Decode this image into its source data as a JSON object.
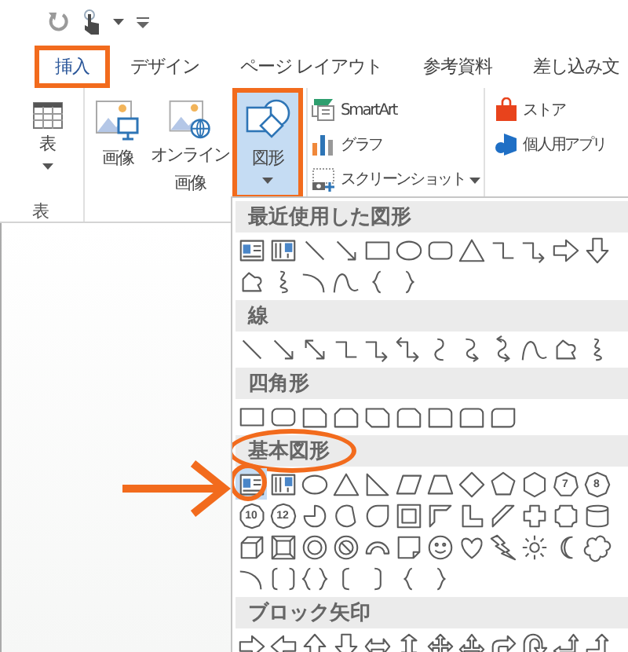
{
  "tabs": [
    {
      "label": "挿入",
      "selected": true,
      "outlined": true
    },
    {
      "label": "デザイン",
      "selected": false,
      "outlined": false
    },
    {
      "label": "ページ レイアウト",
      "selected": false,
      "outlined": false
    },
    {
      "label": "参考資料",
      "selected": false,
      "outlined": false
    },
    {
      "label": "差し込み文",
      "selected": false,
      "outlined": false
    }
  ],
  "ribbon": {
    "groups": [
      {
        "kind": "large",
        "label": "表",
        "items": [
          {
            "kind": "table",
            "label": "表",
            "dropdown": true,
            "pressed": false,
            "outlined": false
          }
        ]
      },
      {
        "kind": "large",
        "items": [
          {
            "kind": "picture",
            "label": "画像",
            "dropdown": false,
            "pressed": false,
            "outlined": false
          },
          {
            "kind": "online-picture",
            "lines": [
              "オンライン",
              "画像"
            ],
            "dropdown": false,
            "pressed": false,
            "outlined": false
          },
          {
            "kind": "shapes",
            "label": "図形",
            "dropdown": true,
            "pressed": true,
            "outlined": true
          }
        ]
      },
      {
        "kind": "small",
        "items": [
          {
            "kind": "smartart",
            "label": "SmartArt",
            "dropdown": false
          },
          {
            "kind": "chart",
            "label": "グラフ",
            "dropdown": false
          },
          {
            "kind": "screenshot",
            "label": "スクリーンショット",
            "dropdown": true
          }
        ]
      },
      {
        "kind": "small",
        "items": [
          {
            "kind": "store",
            "label": "ストア",
            "dropdown": false
          },
          {
            "kind": "apps",
            "label": "個人用アプリ",
            "dropdown": false
          }
        ]
      }
    ]
  },
  "shape_gallery": {
    "sections": [
      {
        "title": "最近使用した図形",
        "circled": false,
        "items": [
          {
            "kind": "text-box",
            "selected": false,
            "circled": false
          },
          {
            "kind": "vertical-text-box",
            "selected": false,
            "circled": false
          },
          {
            "kind": "line",
            "selected": false,
            "circled": false
          },
          {
            "kind": "arrow",
            "selected": false,
            "circled": false
          },
          {
            "kind": "rectangle",
            "selected": false,
            "circled": false
          },
          {
            "kind": "oval",
            "selected": false,
            "circled": false
          },
          {
            "kind": "rounded-rectangle",
            "selected": false,
            "circled": false
          },
          {
            "kind": "triangle",
            "selected": false,
            "circled": false
          },
          {
            "kind": "elbow-connector",
            "selected": false,
            "circled": false
          },
          {
            "kind": "elbow-arrow",
            "selected": false,
            "circled": false
          },
          {
            "kind": "right-arrow",
            "selected": false,
            "circled": false
          },
          {
            "kind": "down-arrow",
            "selected": false,
            "circled": false
          },
          {
            "kind": "freeform",
            "selected": false,
            "circled": false
          },
          {
            "kind": "scribble",
            "selected": false,
            "circled": false
          },
          {
            "kind": "arc",
            "selected": false,
            "circled": false
          },
          {
            "kind": "curve",
            "selected": false,
            "circled": false
          },
          {
            "kind": "left-brace",
            "selected": false,
            "circled": false
          },
          {
            "kind": "right-brace",
            "selected": false,
            "circled": false
          }
        ]
      },
      {
        "title": "線",
        "circled": false,
        "items": [
          {
            "kind": "line",
            "selected": false,
            "circled": false
          },
          {
            "kind": "arrow",
            "selected": false,
            "circled": false
          },
          {
            "kind": "double-arrow",
            "selected": false,
            "circled": false
          },
          {
            "kind": "elbow-connector",
            "selected": false,
            "circled": false
          },
          {
            "kind": "elbow-arrow",
            "selected": false,
            "circled": false
          },
          {
            "kind": "elbow-double-arrow",
            "selected": false,
            "circled": false
          },
          {
            "kind": "curved-connector",
            "selected": false,
            "circled": false
          },
          {
            "kind": "curved-arrow",
            "selected": false,
            "circled": false
          },
          {
            "kind": "curved-double-arrow",
            "selected": false,
            "circled": false
          },
          {
            "kind": "curve",
            "selected": false,
            "circled": false
          },
          {
            "kind": "freeform",
            "selected": false,
            "circled": false
          },
          {
            "kind": "scribble",
            "selected": false,
            "circled": false
          }
        ]
      },
      {
        "title": "四角形",
        "circled": false,
        "items": [
          {
            "kind": "rectangle",
            "selected": false,
            "circled": false
          },
          {
            "kind": "rounded-rectangle",
            "selected": false,
            "circled": false
          },
          {
            "kind": "snip-rectangle",
            "selected": false,
            "circled": false
          },
          {
            "kind": "snip-same-rectangle",
            "selected": false,
            "circled": false
          },
          {
            "kind": "snip-diagonal-rectangle",
            "selected": false,
            "circled": false
          },
          {
            "kind": "snip-round-rectangle",
            "selected": false,
            "circled": false
          },
          {
            "kind": "round-one-rectangle",
            "selected": false,
            "circled": false
          },
          {
            "kind": "round-same-rectangle",
            "selected": false,
            "circled": false
          },
          {
            "kind": "round-diagonal-rectangle",
            "selected": false,
            "circled": false
          }
        ]
      },
      {
        "title": "基本図形",
        "circled": true,
        "items": [
          {
            "kind": "text-box",
            "selected": true,
            "circled": true
          },
          {
            "kind": "vertical-text-box",
            "selected": false,
            "circled": false
          },
          {
            "kind": "oval",
            "selected": false,
            "circled": false
          },
          {
            "kind": "triangle",
            "selected": false,
            "circled": false
          },
          {
            "kind": "right-triangle",
            "selected": false,
            "circled": false
          },
          {
            "kind": "parallelogram",
            "selected": false,
            "circled": false
          },
          {
            "kind": "trapezoid",
            "selected": false,
            "circled": false
          },
          {
            "kind": "diamond",
            "selected": false,
            "circled": false
          },
          {
            "kind": "pentagon",
            "selected": false,
            "circled": false
          },
          {
            "kind": "hexagon",
            "selected": false,
            "circled": false
          },
          {
            "kind": "heptagon",
            "label": "7",
            "selected": false,
            "circled": false
          },
          {
            "kind": "octagon",
            "label": "8",
            "selected": false,
            "circled": false
          },
          {
            "kind": "decagon",
            "label": "10",
            "selected": false,
            "circled": false
          },
          {
            "kind": "dodecagon",
            "label": "12",
            "selected": false,
            "circled": false
          },
          {
            "kind": "pie",
            "selected": false,
            "circled": false
          },
          {
            "kind": "chord",
            "selected": false,
            "circled": false
          },
          {
            "kind": "teardrop",
            "selected": false,
            "circled": false
          },
          {
            "kind": "frame",
            "selected": false,
            "circled": false
          },
          {
            "kind": "half-frame",
            "selected": false,
            "circled": false
          },
          {
            "kind": "l-shape",
            "selected": false,
            "circled": false
          },
          {
            "kind": "diagonal-stripe",
            "selected": false,
            "circled": false
          },
          {
            "kind": "cross",
            "selected": false,
            "circled": false
          },
          {
            "kind": "plaque",
            "selected": false,
            "circled": false
          },
          {
            "kind": "can",
            "selected": false,
            "circled": false
          },
          {
            "kind": "cube",
            "selected": false,
            "circled": false
          },
          {
            "kind": "bevel",
            "selected": false,
            "circled": false
          },
          {
            "kind": "donut",
            "selected": false,
            "circled": false
          },
          {
            "kind": "no-symbol",
            "selected": false,
            "circled": false
          },
          {
            "kind": "block-arc",
            "selected": false,
            "circled": false
          },
          {
            "kind": "folded-corner",
            "selected": false,
            "circled": false
          },
          {
            "kind": "smiley",
            "selected": false,
            "circled": false
          },
          {
            "kind": "heart",
            "selected": false,
            "circled": false
          },
          {
            "kind": "lightning",
            "selected": false,
            "circled": false
          },
          {
            "kind": "sun",
            "selected": false,
            "circled": false
          },
          {
            "kind": "moon",
            "selected": false,
            "circled": false
          },
          {
            "kind": "cloud",
            "selected": false,
            "circled": false
          },
          {
            "kind": "arc",
            "selected": false,
            "circled": false
          },
          {
            "kind": "bracket-pair",
            "selected": false,
            "circled": false
          },
          {
            "kind": "brace-pair",
            "selected": false,
            "circled": false
          },
          {
            "kind": "left-bracket",
            "selected": false,
            "circled": false
          },
          {
            "kind": "right-bracket",
            "selected": false,
            "circled": false
          },
          {
            "kind": "left-brace",
            "selected": false,
            "circled": false
          },
          {
            "kind": "right-brace",
            "selected": false,
            "circled": false
          }
        ]
      },
      {
        "title": "ブロック矢印",
        "circled": false,
        "items": [
          {
            "kind": "right-arrow",
            "selected": false,
            "circled": false
          },
          {
            "kind": "left-arrow",
            "selected": false,
            "circled": false
          },
          {
            "kind": "up-arrow",
            "selected": false,
            "circled": false
          },
          {
            "kind": "down-arrow",
            "selected": false,
            "circled": false
          },
          {
            "kind": "left-right-arrow",
            "selected": false,
            "circled": false
          },
          {
            "kind": "up-down-arrow",
            "selected": false,
            "circled": false
          },
          {
            "kind": "quad-arrow",
            "selected": false,
            "circled": false
          },
          {
            "kind": "left-right-up-arrow",
            "selected": false,
            "circled": false
          },
          {
            "kind": "bent-arrow",
            "selected": false,
            "circled": false
          },
          {
            "kind": "u-turn-arrow",
            "selected": false,
            "circled": false
          },
          {
            "kind": "left-up-arrow",
            "selected": false,
            "circled": false
          },
          {
            "kind": "bent-up-arrow",
            "selected": false,
            "circled": false
          }
        ]
      }
    ]
  },
  "pointer_arrow": true
}
